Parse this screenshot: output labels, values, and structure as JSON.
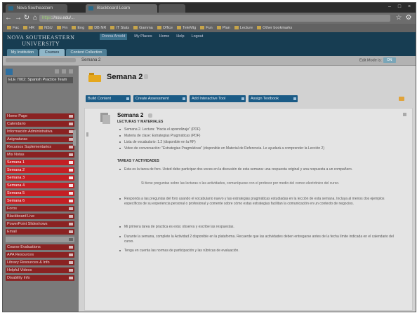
{
  "browser": {
    "tabs": [
      {
        "label": "Nova Southeastern"
      },
      {
        "label": "Blackboard Learn"
      },
      {
        "label": ""
      }
    ],
    "url_secure": "https",
    "url_rest": "://nsu.edu/..."
  },
  "bookmarks": [
    {
      "label": "Fac"
    },
    {
      "label": "HR"
    },
    {
      "label": "NSU"
    },
    {
      "label": "Fin"
    },
    {
      "label": "Eng"
    },
    {
      "label": "DB NR"
    },
    {
      "label": "IT Stats"
    },
    {
      "label": "Gamma"
    },
    {
      "label": "Office"
    },
    {
      "label": "TeleMtg"
    },
    {
      "label": "Fun"
    },
    {
      "label": "Plan"
    },
    {
      "label": "Lecture"
    },
    {
      "label": "Other bookmarks"
    }
  ],
  "university": {
    "line1": "NOVA SOUTHEASTERN",
    "line2": "UNIVERSITY",
    "top_links": [
      "Donna Arnold",
      "My Places",
      "Home",
      "Help",
      "Logout"
    ],
    "tabs": [
      {
        "label": "My Institution"
      },
      {
        "label": "Courses"
      },
      {
        "label": "Content Collection"
      }
    ]
  },
  "breadcrumb": {
    "current": "Semana 2",
    "edit_mode_label": "Edit Mode is:",
    "edit_mode_value": "ON"
  },
  "sidebar": {
    "course_title": "ELE 7002: Spanish Practice Team",
    "items": [
      {
        "label": "Home Page",
        "style": "dark"
      },
      {
        "label": "Calendario",
        "style": "dark"
      },
      {
        "label": "Información Administrativa",
        "style": "dark"
      },
      {
        "label": "Asignaturas",
        "style": "dark"
      },
      {
        "label": "Recursos Suplementarios",
        "style": "dark"
      },
      {
        "label": "Mis Notas",
        "style": "dark"
      },
      {
        "label": "Semana 1",
        "style": "bright"
      },
      {
        "label": "Semana 2",
        "style": "bright"
      },
      {
        "label": "Semana 3",
        "style": "bright"
      },
      {
        "label": "Semana 4",
        "style": "bright"
      },
      {
        "label": "Semana 5",
        "style": "bright"
      },
      {
        "label": "Semana 6",
        "style": "bright"
      },
      {
        "label": "Foros",
        "style": "dark"
      },
      {
        "label": "Blackboard Live",
        "style": "dark"
      },
      {
        "label": "PowerPoint Slideshows",
        "style": "dark"
      },
      {
        "label": "Email",
        "style": "dark"
      },
      {
        "label": "",
        "style": "gray"
      },
      {
        "label": "Course Evaluations",
        "style": "dark"
      },
      {
        "label": "APA Resources",
        "style": "dark"
      },
      {
        "label": "Library Resources & Info",
        "style": "dark"
      },
      {
        "label": "Helpful Videos",
        "style": "dark"
      },
      {
        "label": "Disability Info",
        "style": "dark"
      }
    ]
  },
  "page": {
    "title": "Semana 2",
    "toolbar": [
      {
        "label": "Build Content"
      },
      {
        "label": "Create Assessment"
      },
      {
        "label": "Add Interactive Tool"
      },
      {
        "label": "Assign Textbook"
      }
    ]
  },
  "content_item": {
    "title": "Semana 2",
    "section1_heading": "LECTURAS Y MATERIALES",
    "section1_bullets": [
      "Semana 2. Lectura: \"Hacia el aprendizaje\" (PDF)",
      "Materia de clase: Estrategias Pragmáticas (PDF)",
      "Lista de vocabulario: 1.2 (disponible en la RF)",
      "Video de conversación: \"Estrategias Pragmáticas\" (disponible en Material de Referencia. Le ayudará a comprender la Lección 2)"
    ],
    "section2_heading": "TAREAS Y ACTIVIDADES",
    "section2_bullets": [
      "Esta es la tarea de foro. Usted debe participar dos veces en la discusión de esta semana: una respuesta original y una respuesta a un compañero.",
      "Responda a las preguntas del foro usando el vocabulario nuevo y las estrategias pragmáticas estudiadas en la lección de esta semana. Incluya al menos dos ejemplos específicos de su experiencia personal o profesional y comente sobre cómo estas estrategias facilitan la comunicación en un contexto de negocios.",
      "Mi primera tarea de practica es esta: observa y escribe las respuestas.",
      "Durante la semana, complete la Actividad 2 disponible en la plataforma. Recuerde que las actividades deben entregarse antes de la fecha límite indicada en el calendario del curso.",
      "Tenga en cuenta las normas de participación y las rúbricas de evaluación."
    ],
    "reference": "Si tiene preguntas sobre las lecturas o las actividades, comuníquese con el profesor por medio del correo electrónico del curso."
  }
}
